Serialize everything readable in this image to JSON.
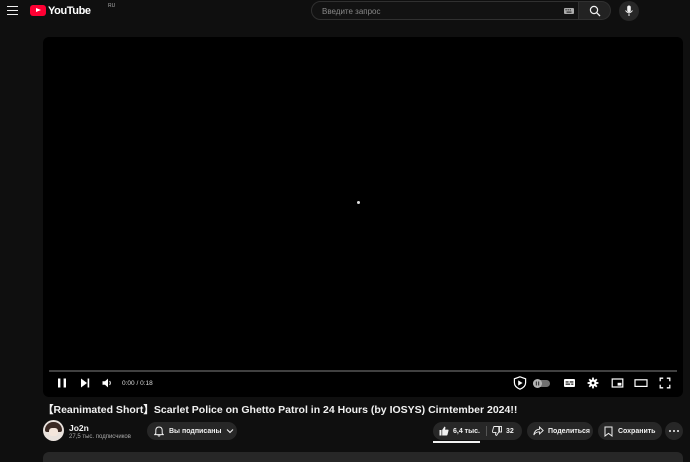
{
  "header": {
    "menu_icon": "hamburger-menu-icon",
    "logo_text": "YouTube",
    "logo_region": "RU",
    "search_placeholder": "Введите запрос",
    "search_icon": "search-icon",
    "keyboard_icon": "keyboard-icon",
    "mic_icon": "microphone-icon"
  },
  "player": {
    "time_current": "0:00",
    "time_separator": "/",
    "time_total": "0:18",
    "progress": 0,
    "icons": [
      "pause-icon",
      "next-icon",
      "volume-icon",
      "ad-block-shield-icon",
      "autoplay-toggle",
      "subtitles-icon",
      "settings-gear-icon",
      "miniplayer-icon",
      "theater-mode-icon",
      "fullscreen-icon"
    ],
    "accent_color": "#ff0000"
  },
  "video": {
    "title": "【Reanimated Short】Scarlet Police on Ghetto Patrol in 24 Hours (by IOSYS) Cirntember 2024!!"
  },
  "channel": {
    "name": "Jo2n",
    "subscribers": "27,5 тыс. подписчиков",
    "subscribe_label": "Вы подписаны"
  },
  "actions": {
    "likes": "6,4 тыс.",
    "dislikes": "32",
    "share_label": "Поделиться",
    "save_label": "Сохранить"
  },
  "colors": {
    "background": "#0f0f0f",
    "pill_background": "#272727",
    "logo_red": "#ff0033"
  }
}
